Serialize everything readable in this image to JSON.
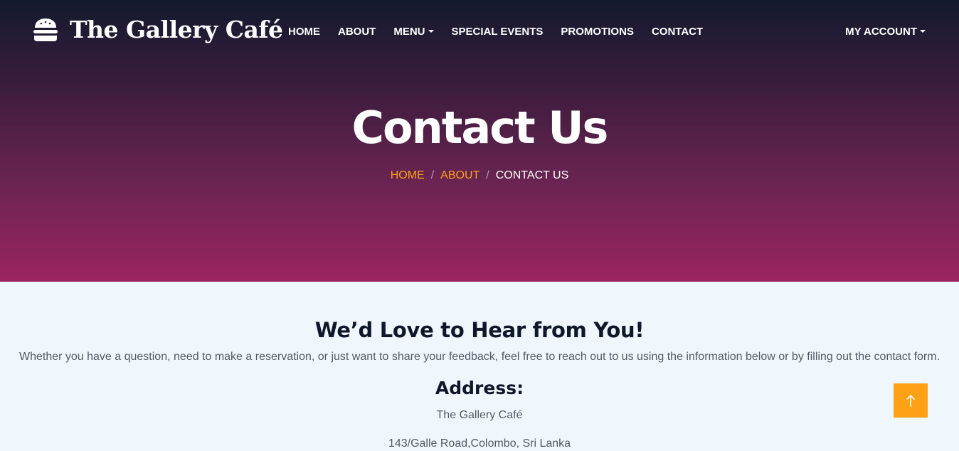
{
  "brand": {
    "name": "The Gallery Café",
    "icon": "hamburger-icon"
  },
  "nav": {
    "items": [
      {
        "label": "HOME"
      },
      {
        "label": "ABOUT"
      },
      {
        "label": "MENU"
      },
      {
        "label": "SPECIAL EVENTS"
      },
      {
        "label": "PROMOTIONS"
      },
      {
        "label": "CONTACT"
      }
    ],
    "account": "MY ACCOUNT"
  },
  "hero": {
    "title": "Contact Us",
    "breadcrumb": {
      "home": "HOME",
      "about": "ABOUT",
      "current": "CONTACT US",
      "separator": "/"
    }
  },
  "content": {
    "heading": "We’d Love to Hear from You!",
    "intro": "Whether you have a question, need to make a reservation, or just want to share your feedback, feel free to reach out to us using the information below or by filling out the contact form.",
    "address_heading": "Address:",
    "address_lines": [
      "The Gallery Café",
      "143/Galle Road,Colombo, Sri Lanka"
    ]
  },
  "back_to_top": {
    "icon": "arrow-up-icon"
  },
  "colors": {
    "accent": "#fea116",
    "dark": "#0f172b",
    "hero_top": "#121a2e",
    "hero_bottom": "#9b2460",
    "section_bg": "#f0f7fc"
  }
}
